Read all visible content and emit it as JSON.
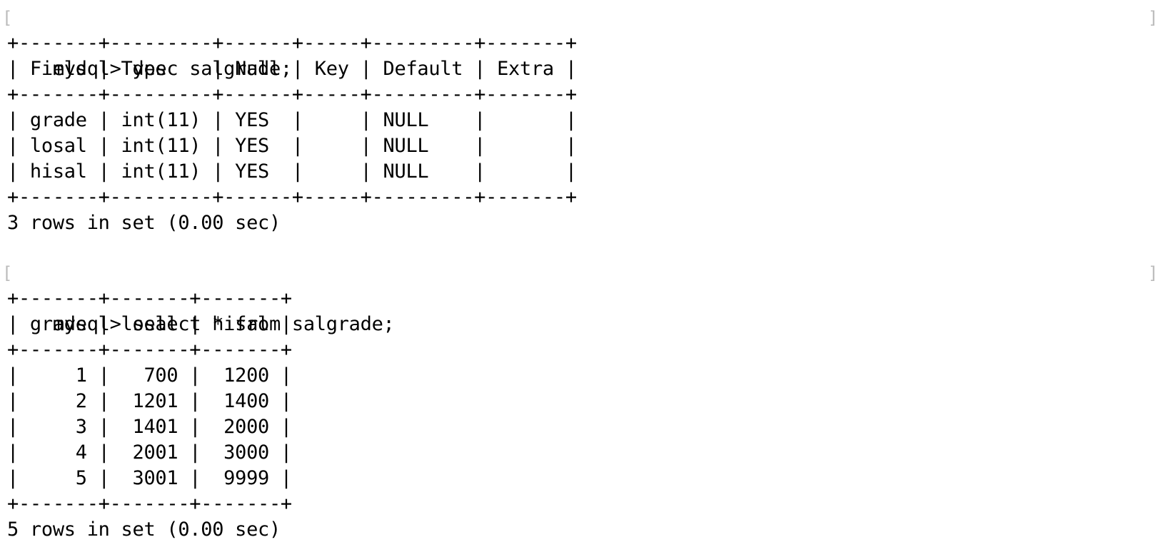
{
  "session": {
    "block1": {
      "prompt": "mysql> desc salgrade;",
      "lines": [
        "+-------+---------+------+-----+---------+-------+",
        "| Field | Type    | Null | Key | Default | Extra |",
        "+-------+---------+------+-----+---------+-------+",
        "| grade | int(11) | YES  |     | NULL    |       |",
        "| losal | int(11) | YES  |     | NULL    |       |",
        "| hisal | int(11) | YES  |     | NULL    |       |",
        "+-------+---------+------+-----+---------+-------+",
        "3 rows in set (0.00 sec)"
      ]
    },
    "block2": {
      "prompt": "mysql> select * from salgrade;",
      "lines": [
        "+-------+-------+-------+",
        "| grade | losal | hisal |",
        "+-------+-------+-------+",
        "|     1 |   700 |  1200 |",
        "|     2 |  1201 |  1400 |",
        "|     3 |  1401 |  2000 |",
        "|     4 |  2001 |  3000 |",
        "|     5 |  3001 |  9999 |",
        "+-------+-------+-------+",
        "5 rows in set (0.00 sec)"
      ]
    }
  },
  "brackets": {
    "left": "[",
    "right": "]"
  }
}
